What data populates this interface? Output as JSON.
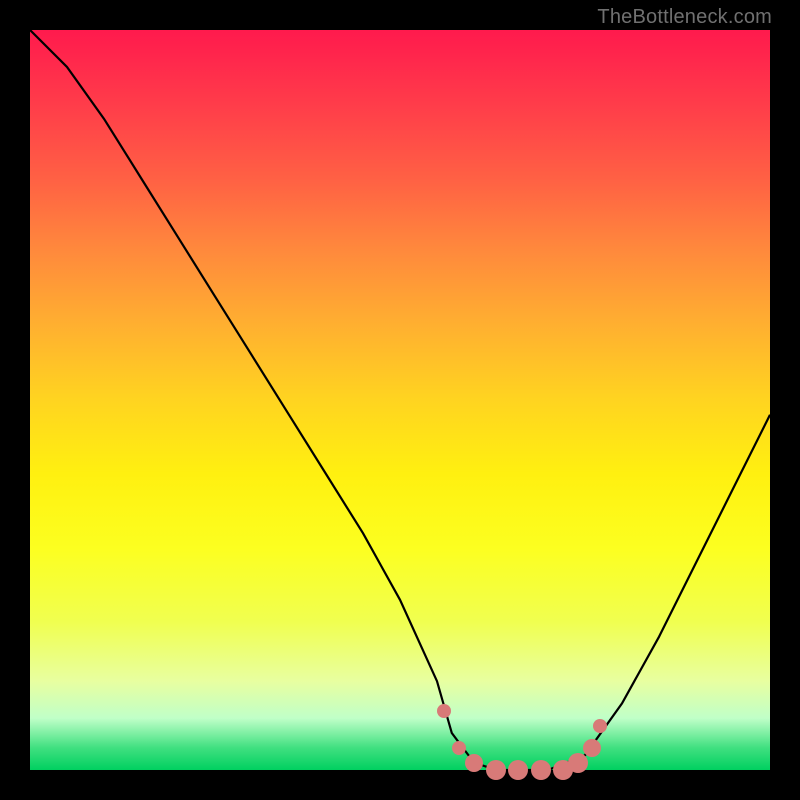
{
  "watermark": "TheBottleneck.com",
  "chart_data": {
    "type": "line",
    "title": "",
    "xlabel": "",
    "ylabel": "",
    "xlim": [
      0,
      100
    ],
    "ylim": [
      0,
      100
    ],
    "series": [
      {
        "name": "bottleneck-curve",
        "x": [
          0,
          5,
          10,
          15,
          20,
          25,
          30,
          35,
          40,
          45,
          50,
          55,
          57,
          60,
          63,
          66,
          70,
          75,
          80,
          85,
          90,
          95,
          100
        ],
        "y": [
          100,
          95,
          88,
          80,
          72,
          64,
          56,
          48,
          40,
          32,
          23,
          12,
          5,
          1,
          0,
          0,
          0,
          2,
          9,
          18,
          28,
          38,
          48
        ]
      }
    ],
    "markers": {
      "name": "highlight-dots",
      "color": "#d87a78",
      "points": [
        {
          "x": 56,
          "y": 8,
          "r": 7
        },
        {
          "x": 58,
          "y": 3,
          "r": 7
        },
        {
          "x": 60,
          "y": 1,
          "r": 9
        },
        {
          "x": 63,
          "y": 0,
          "r": 10
        },
        {
          "x": 66,
          "y": 0,
          "r": 10
        },
        {
          "x": 69,
          "y": 0,
          "r": 10
        },
        {
          "x": 72,
          "y": 0,
          "r": 10
        },
        {
          "x": 74,
          "y": 1,
          "r": 10
        },
        {
          "x": 76,
          "y": 3,
          "r": 9
        },
        {
          "x": 77,
          "y": 6,
          "r": 7
        }
      ]
    }
  }
}
